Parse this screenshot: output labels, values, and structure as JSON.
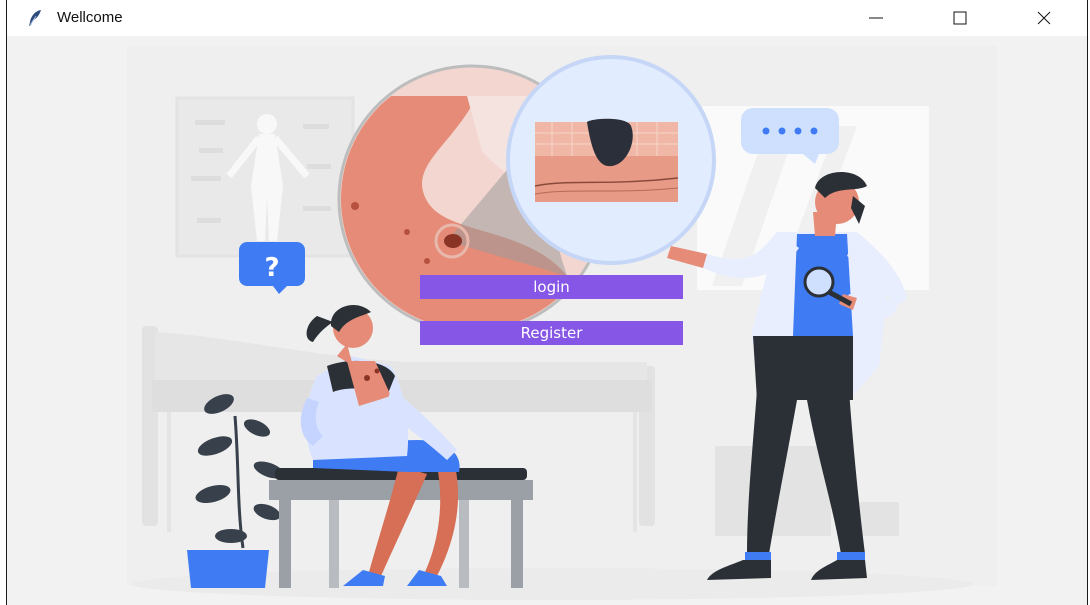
{
  "window": {
    "title": "Wellcome",
    "icon": "feather-icon",
    "controls": [
      "minimize-icon",
      "maximize-icon",
      "close-icon"
    ]
  },
  "buttons": {
    "login_label": "login",
    "register_label": "Register"
  },
  "illustration": {
    "question_mark": "?"
  },
  "colors": {
    "button_bg": "#8657e6",
    "button_text": "#ffffff",
    "accent_blue": "#3f7cf4",
    "skin_lesion": "#e58b77"
  }
}
